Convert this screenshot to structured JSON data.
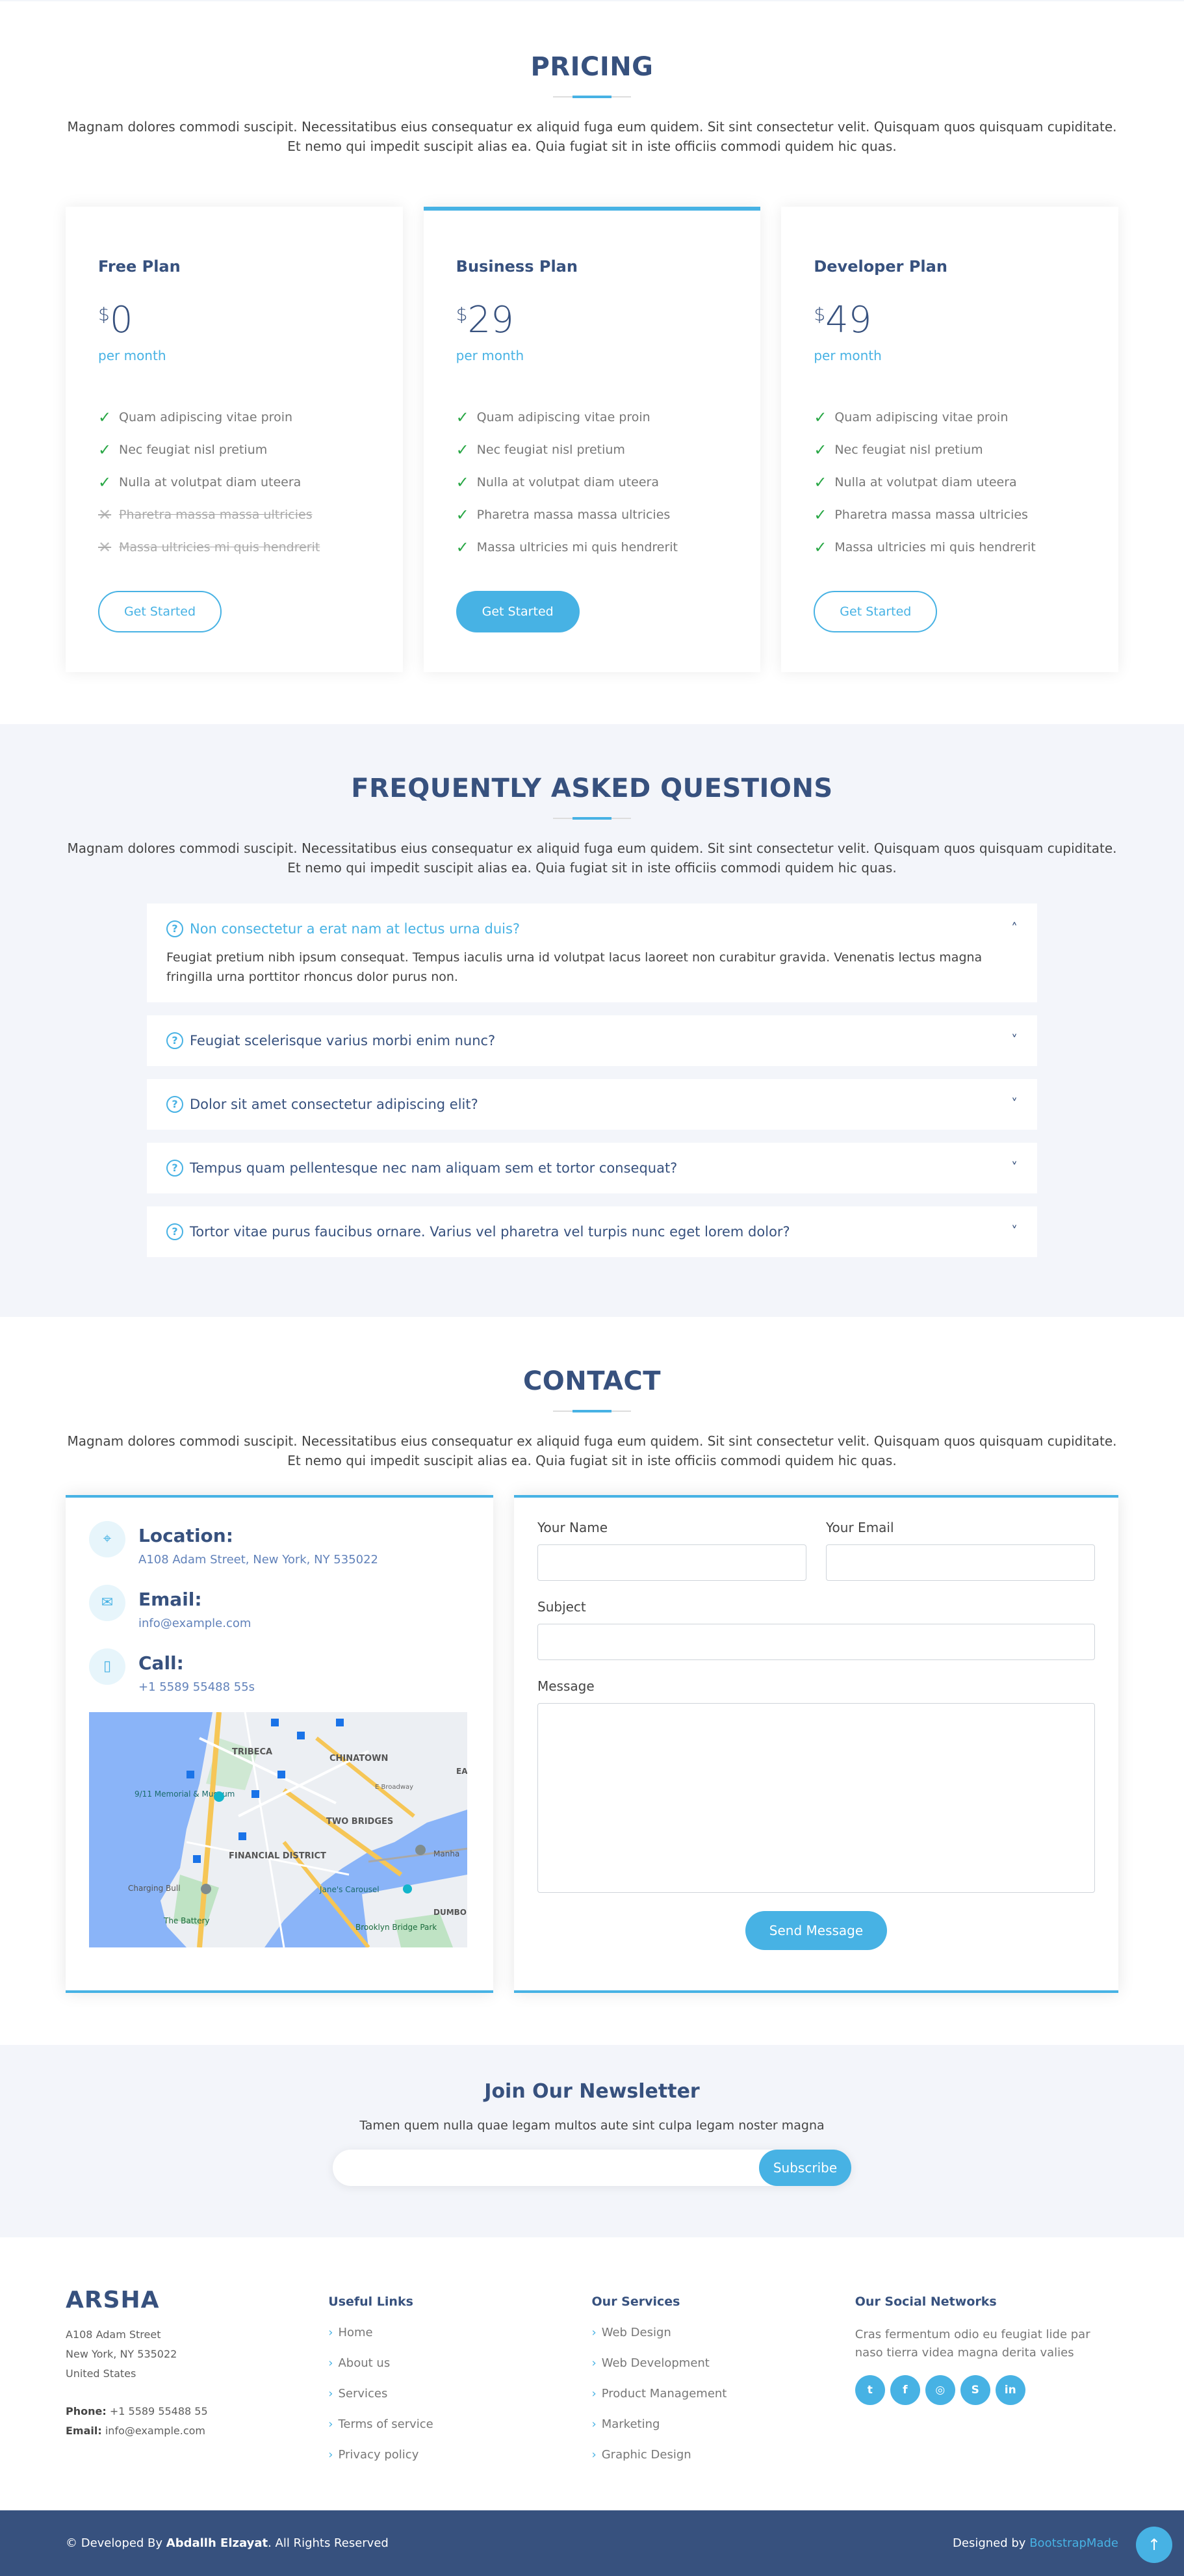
{
  "pricing": {
    "title": "PRICING",
    "description": "Magnam dolores commodi suscipit. Necessitatibus eius consequatur ex aliquid fuga eum quidem. Sit sint consectetur velit. Quisquam quos quisquam cupiditate. Et nemo qui impedit suscipit alias ea. Quia fugiat sit in iste officiis commodi quidem hic quas.",
    "plans": [
      {
        "name": "Free Plan",
        "currency": "$",
        "price": "0",
        "period": "per month",
        "button": "Get Started",
        "features": [
          "Quam adipiscing vitae proin",
          "Nec feugiat nisl pretium",
          "Nulla at volutpat diam uteera",
          "Pharetra massa massa ultricies",
          "Massa ultricies mi quis hendrerit"
        ],
        "included": [
          true,
          true,
          true,
          false,
          false
        ]
      },
      {
        "name": "Business Plan",
        "currency": "$",
        "price": "29",
        "period": "per month",
        "button": "Get Started",
        "features": [
          "Quam adipiscing vitae proin",
          "Nec feugiat nisl pretium",
          "Nulla at volutpat diam uteera",
          "Pharetra massa massa ultricies",
          "Massa ultricies mi quis hendrerit"
        ],
        "included": [
          true,
          true,
          true,
          true,
          true
        ]
      },
      {
        "name": "Developer Plan",
        "currency": "$",
        "price": "49",
        "period": "per month",
        "button": "Get Started",
        "features": [
          "Quam adipiscing vitae proin",
          "Nec feugiat nisl pretium",
          "Nulla at volutpat diam uteera",
          "Pharetra massa massa ultricies",
          "Massa ultricies mi quis hendrerit"
        ],
        "included": [
          true,
          true,
          true,
          true,
          true
        ]
      }
    ]
  },
  "faq": {
    "title": "FREQUENTLY ASKED QUESTIONS",
    "description": "Magnam dolores commodi suscipit. Necessitatibus eius consequatur ex aliquid fuga eum quidem. Sit sint consectetur velit. Quisquam quos quisquam cupiditate. Et nemo qui impedit suscipit alias ea. Quia fugiat sit in iste officiis commodi quidem hic quas.",
    "items": [
      {
        "question": "Non consectetur a erat nam at lectus urna duis?",
        "answer": "Feugiat pretium nibh ipsum consequat. Tempus iaculis urna id volutpat lacus laoreet non curabitur gravida. Venenatis lectus magna fringilla urna porttitor rhoncus dolor purus non."
      },
      {
        "question": "Feugiat scelerisque varius morbi enim nunc?"
      },
      {
        "question": "Dolor sit amet consectetur adipiscing elit?"
      },
      {
        "question": "Tempus quam pellentesque nec nam aliquam sem et tortor consequat?"
      },
      {
        "question": "Tortor vitae purus faucibus ornare. Varius vel pharetra vel turpis nunc eget lorem dolor?"
      }
    ]
  },
  "contact": {
    "title": "CONTACT",
    "description": "Magnam dolores commodi suscipit. Necessitatibus eius consequatur ex aliquid fuga eum quidem. Sit sint consectetur velit. Quisquam quos quisquam cupiditate. Et nemo qui impedit suscipit alias ea. Quia fugiat sit in iste officiis commodi quidem hic quas.",
    "location_label": "Location:",
    "location_value": "A108 Adam Street, New York, NY 535022",
    "email_label": "Email:",
    "email_value": "info@example.com",
    "call_label": "Call:",
    "call_value": "+1 5589 55488 55s",
    "map_labels": [
      "TRIBECA",
      "CHINATOWN",
      "9/11 Memorial & Museum",
      "TWO BRIDGES",
      "FINANCIAL DISTRICT",
      "Charging Bull",
      "Jane's Carousel",
      "The Battery",
      "Brooklyn Bridge Park",
      "Manha",
      "DUMBO",
      "EA",
      "E Broadway"
    ],
    "form": {
      "name_label": "Your Name",
      "email_label": "Your Email",
      "subject_label": "Subject",
      "message_label": "Message",
      "submit": "Send Message"
    }
  },
  "newsletter": {
    "title": "Join Our Newsletter",
    "text": "Tamen quem nulla quae legam multos aute sint culpa legam noster magna",
    "button": "Subscribe"
  },
  "footer": {
    "brand": "ARSHA",
    "address1": "A108 Adam Street",
    "address2": "New York, NY 535022",
    "address3": "United States",
    "phone_label": "Phone:",
    "phone_value": "+1 5589 55488 55",
    "email_label": "Email:",
    "email_value": "info@example.com",
    "useful_title": "Useful Links",
    "useful_links": [
      "Home",
      "About us",
      "Services",
      "Terms of service",
      "Privacy policy"
    ],
    "services_title": "Our Services",
    "services_links": [
      "Web Design",
      "Web Development",
      "Product Management",
      "Marketing",
      "Graphic Design"
    ],
    "social_title": "Our Social Networks",
    "social_text": "Cras fermentum odio eu feugiat lide par naso tierra videa magna derita valies",
    "social_icons": [
      "twitter-icon",
      "facebook-icon",
      "instagram-icon",
      "skype-icon",
      "linkedin-icon"
    ],
    "copyright_prefix": "© Developed By",
    "copyright_name": "Abdallh Elzayat",
    "copyright_suffix": ". All Rights Reserved",
    "designed_by": "Designed by",
    "designer": "BootstrapMade"
  },
  "colors": {
    "accent": "#47b2e4",
    "heading": "#37517e",
    "light_bg": "#f3f5fa"
  }
}
